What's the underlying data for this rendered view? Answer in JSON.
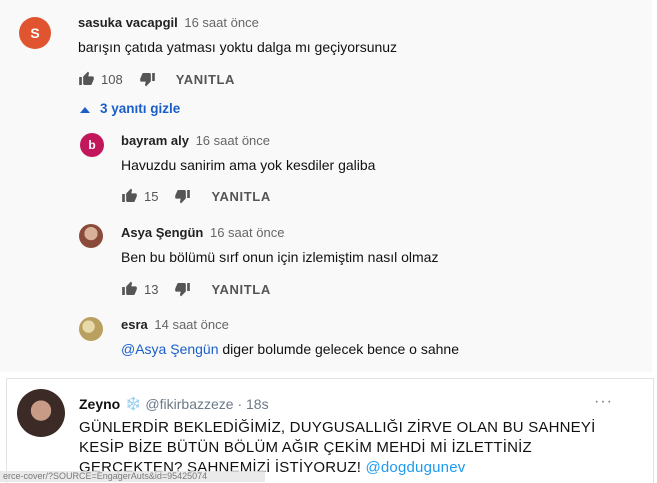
{
  "comments": [
    {
      "author": "sasuka vacapgil",
      "time": "16 saat önce",
      "text": "barışın çatıda yatması yoktu dalga mı geçiyorsunuz",
      "likes": "108",
      "reply_label": "YANITLA",
      "avatar_letter": "S",
      "avatar_color": "#e0552f"
    },
    {
      "author": "bayram aly",
      "time": "16 saat önce",
      "text": "Havuzdu sanirim ama yok kesdiler galiba",
      "likes": "15",
      "reply_label": "YANITLA",
      "avatar_letter": "b",
      "avatar_color": "#c2185b"
    },
    {
      "author": "Asya Şengün",
      "time": "16 saat önce",
      "text": "Ben bu bölümü sırf onun için izlemiştim nasıl olmaz",
      "likes": "13",
      "reply_label": "YANITLA"
    },
    {
      "author": "esra",
      "time": "14 saat önce",
      "mention": "@Asya Şengün",
      "text": " diger bolumde gelecek bence o sahne"
    }
  ],
  "replies_toggle": {
    "label": "3 yanıtı gizle"
  },
  "tweet": {
    "name": "Zeyno",
    "emoji": "❄️",
    "handle": "@fikirbazzeze · 18s",
    "more": "···",
    "body": "GÜNLERDİR BEKLEDİĞİMİZ, DUYGUSALLIĞI ZİRVE OLAN BU SAHNEYİ KESİP BİZE BÜTÜN BÖLÜM AĞIR ÇEKİM MEHDİ Mİ İZLETTİNİZ GERÇEKTEN? SAHNEMİZİ İSTİYORUZ! ",
    "link": "@dogdugunev"
  },
  "source_overlay": "erce-cover/?SOURCE=EngagerAuts&id=95425074",
  "colors": {
    "link": "#1a5fc9",
    "twitter_link": "#1d9bf0"
  }
}
